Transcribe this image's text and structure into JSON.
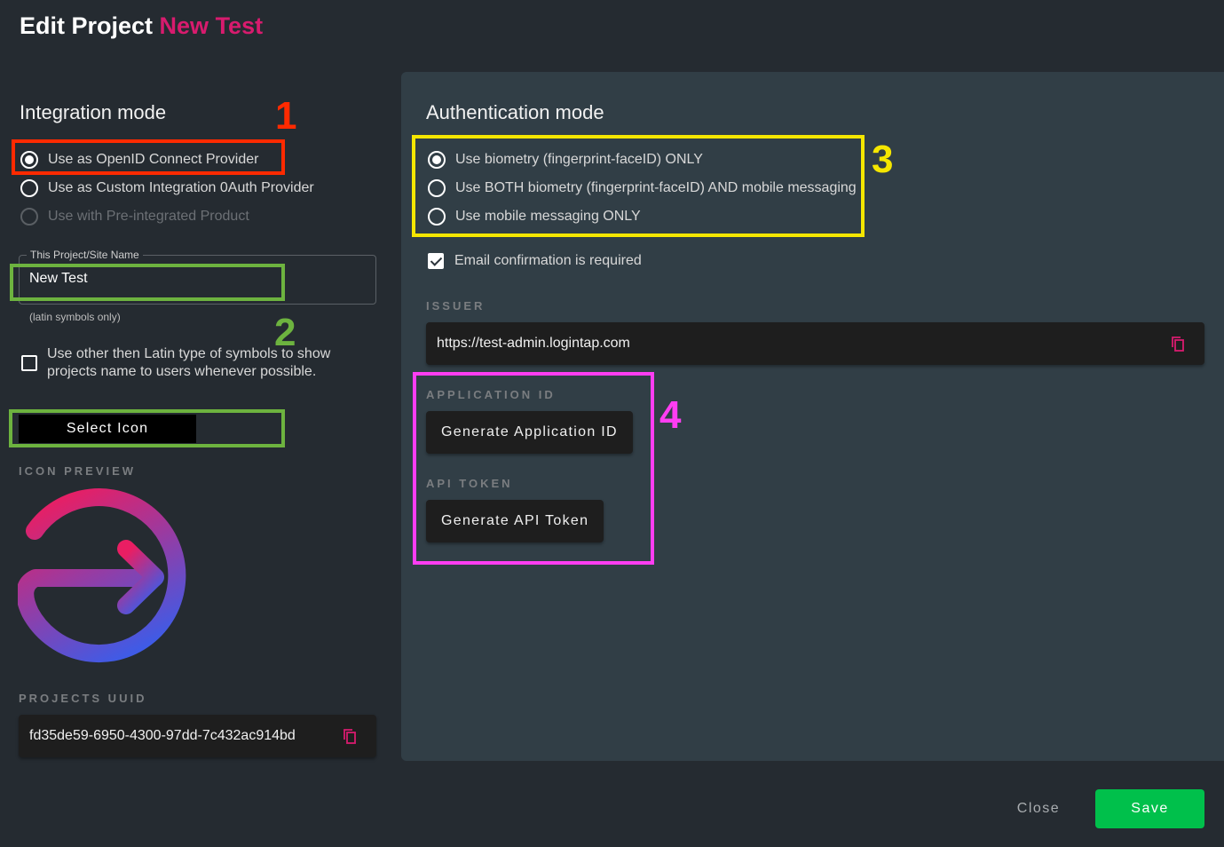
{
  "header": {
    "title_prefix": "Edit Project",
    "title_project": "New Test"
  },
  "integration": {
    "title": "Integration mode",
    "options": [
      {
        "label": "Use as OpenID Connect Provider",
        "checked": true,
        "disabled": false
      },
      {
        "label": "Use as Custom Integration 0Auth Provider",
        "checked": false,
        "disabled": false
      },
      {
        "label": "Use with Pre-integrated Product",
        "checked": false,
        "disabled": true
      }
    ],
    "name_field": {
      "legend": "This Project/Site Name",
      "value": "New Test",
      "helper": "(latin symbols only)"
    },
    "latin_checkbox": {
      "label": "Use other then Latin type of symbols to show projects name to users whenever possible.",
      "checked": false
    },
    "select_icon_label": "Select Icon",
    "icon_preview_label": "ICON PREVIEW",
    "icon_preview_icon": "login-arrow-circle-icon",
    "icon_gradient": [
      "#e91e63",
      "#3f5be6"
    ],
    "uuid_label": "PROJECTS UUID",
    "uuid_value": "fd35de59-6950-4300-97dd-7c432ac914bd"
  },
  "authentication": {
    "title": "Authentication mode",
    "options": [
      {
        "label": "Use biometry (fingerprint-faceID) ONLY",
        "checked": true
      },
      {
        "label": "Use BOTH biometry (fingerprint-faceID) AND mobile messaging",
        "checked": false
      },
      {
        "label": "Use mobile messaging ONLY",
        "checked": false
      }
    ],
    "email_confirmation": {
      "label": "Email confirmation is required",
      "checked": true
    },
    "issuer_label": "ISSUER",
    "issuer_value": "https://test-admin.logintap.com",
    "application_id_label": "APPLICATION ID",
    "generate_app_id_label": "Generate Application ID",
    "api_token_label": "API TOKEN",
    "generate_api_token_label": "Generate API Token"
  },
  "annotations": [
    {
      "number": "1",
      "color": "#ff2a00"
    },
    {
      "number": "2",
      "color": "#6db33f"
    },
    {
      "number": "3",
      "color": "#f5e600"
    },
    {
      "number": "4",
      "color": "#ff3df2"
    }
  ],
  "footer": {
    "close_label": "Close",
    "save_label": "Save"
  },
  "colors": {
    "accent": "#d81b6e",
    "save": "#00c04b",
    "background": "#252b31",
    "panel": "#313e46"
  }
}
